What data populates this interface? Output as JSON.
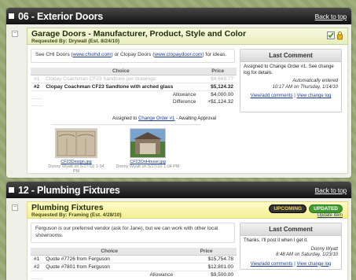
{
  "s1": {
    "title": "06 - Exterior Doors",
    "back": "Back to top",
    "item": {
      "name": "Garage Doors - Manufacturer, Product, Style and Color",
      "requested": "Requested By: Drywall (Est. 8/24/10)",
      "desc_pre": "See CHI Doors (",
      "desc_link1": "www.chiohd.com",
      "desc_mid": ") or Clopay Doors (",
      "desc_link2": "www.clopaydoor.com",
      "desc_post": ") for ideas.",
      "col_choice": "Choice",
      "col_price": "Price",
      "rows": [
        {
          "num": "#1",
          "choice": "Clopay Coachman CF23 Sandtone per drawings",
          "price": "$4,669.77"
        },
        {
          "num": "#2",
          "choice": "Clopay Coachman CF23 Sandtone with arched glass",
          "price": "$5,124.32"
        }
      ],
      "allowance_label": "Allowance",
      "allowance": "$4,000.00",
      "difference_label": "Difference",
      "difference": "+$1,124.32",
      "assign_pre": "Assigned to ",
      "assign_link": "Change Order #1",
      "assign_post": " - Awaiting Approval",
      "last_comment": {
        "header": "Last Comment",
        "text": "Assigned to Change Order #1. See change log for details.",
        "auto": "Automatically entered",
        "when": "10:17 AM on Thursday, 1/14/10",
        "link1": "View/add comments",
        "sep": " | ",
        "link2": "View change log"
      },
      "photos": [
        {
          "file": "CF23Design.jpg",
          "by": "Donny Wyatt on 5/27/10 1:04 PM"
        },
        {
          "file": "CF23OnHouse.jpg",
          "by": "Donny Wyatt on 5/27/10 1:04 PM"
        }
      ]
    }
  },
  "s2": {
    "title": "12 - Plumbing Fixtures",
    "back": "Back to top",
    "item": {
      "name": "Plumbing Fixtures",
      "requested": "Requested By: Framing (Est. 4/28/10)",
      "badge1": "UPCOMING",
      "badge2": "UPDATED",
      "update_link": "Update item",
      "desc": "Ferguson is our preferred vendor (ask for Jane), but we can work with other local showrooms.",
      "col_choice": "Choice",
      "col_price": "Price",
      "rows": [
        {
          "num": "#1",
          "choice": "Quote #7726 from Ferguson",
          "price": "$15,754.78"
        },
        {
          "num": "#2",
          "choice": "Quote #7801 from Ferguson",
          "price": "$12,801.00"
        }
      ],
      "allowance_label": "Allowance",
      "allowance": "$9,500.00",
      "last_comment": {
        "header": "Last Comment",
        "text": "Thanks. I'll post it when I get it.",
        "author": "Donny Wyatt",
        "when": "8:48 AM on Saturday, 1/23/10",
        "link1": "View/add comments",
        "sep": " | ",
        "link2": "View change log"
      }
    }
  }
}
